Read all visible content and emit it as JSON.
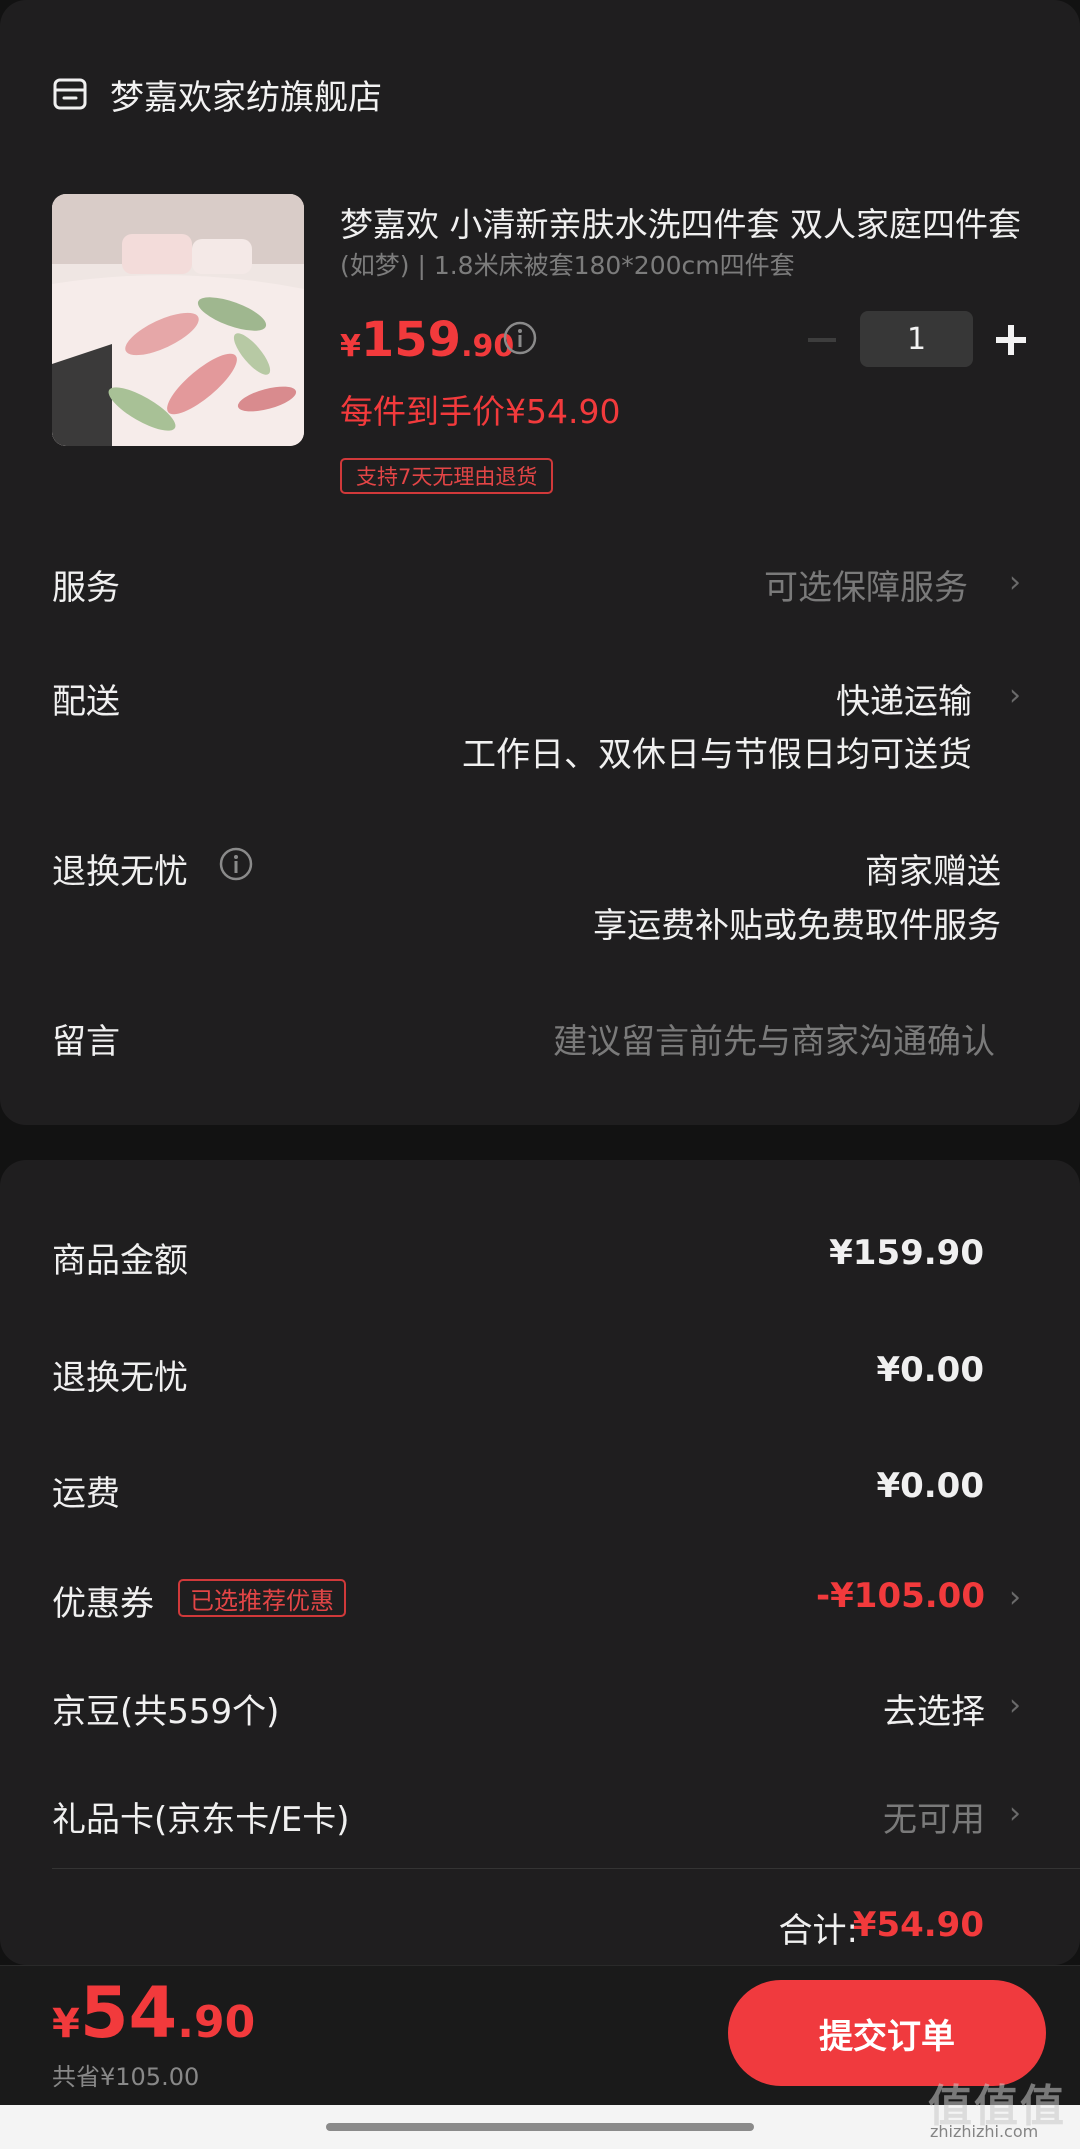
{
  "store": {
    "name": "梦嘉欢家纺旗舰店",
    "icon": "store-icon"
  },
  "product": {
    "title": "梦嘉欢 小清新亲肤水洗四件套 双人家庭四件套",
    "spec": "(如梦) | 1.8米床被套180*200cm四件套",
    "price_currency": "¥",
    "price_int": "159",
    "price_dec": ".90",
    "unit_price": "每件到手价¥54.90",
    "return_tag": "支持7天无理由退货",
    "quantity": "1"
  },
  "rows": {
    "service": {
      "label": "服务",
      "value": "可选保障服务"
    },
    "delivery": {
      "label": "配送",
      "value": "快递运输",
      "sub": "工作日、双休日与节假日均可送货"
    },
    "worry_free": {
      "label": "退换无忧",
      "value": "商家赠送",
      "sub": "享运费补贴或免费取件服务"
    },
    "message": {
      "label": "留言",
      "placeholder": "建议留言前先与商家沟通确认"
    }
  },
  "summary": {
    "goods": {
      "label": "商品金额",
      "value": "¥159.90"
    },
    "worry_free": {
      "label": "退换无忧",
      "value": "¥0.00"
    },
    "shipping": {
      "label": "运费",
      "value": "¥0.00"
    },
    "coupon": {
      "label": "优惠券",
      "tag": "已选推荐优惠",
      "value": "-¥105.00"
    },
    "jingdou": {
      "label": "京豆(共559个)",
      "value": "去选择"
    },
    "giftcard": {
      "label": "礼品卡(京东卡/E卡)",
      "value": "无可用"
    },
    "total_label": "合计:",
    "total_value": "¥54.90"
  },
  "bottom": {
    "currency": "¥",
    "price_int": "54",
    "price_dec": ".90",
    "saved": "共省¥105.00",
    "submit": "提交订单"
  },
  "watermark": {
    "main": "值值值",
    "sub": "zhizhizhi.com"
  },
  "colors": {
    "accent": "#f23a3c",
    "background": "#121212",
    "card": "#1f1e1f"
  }
}
